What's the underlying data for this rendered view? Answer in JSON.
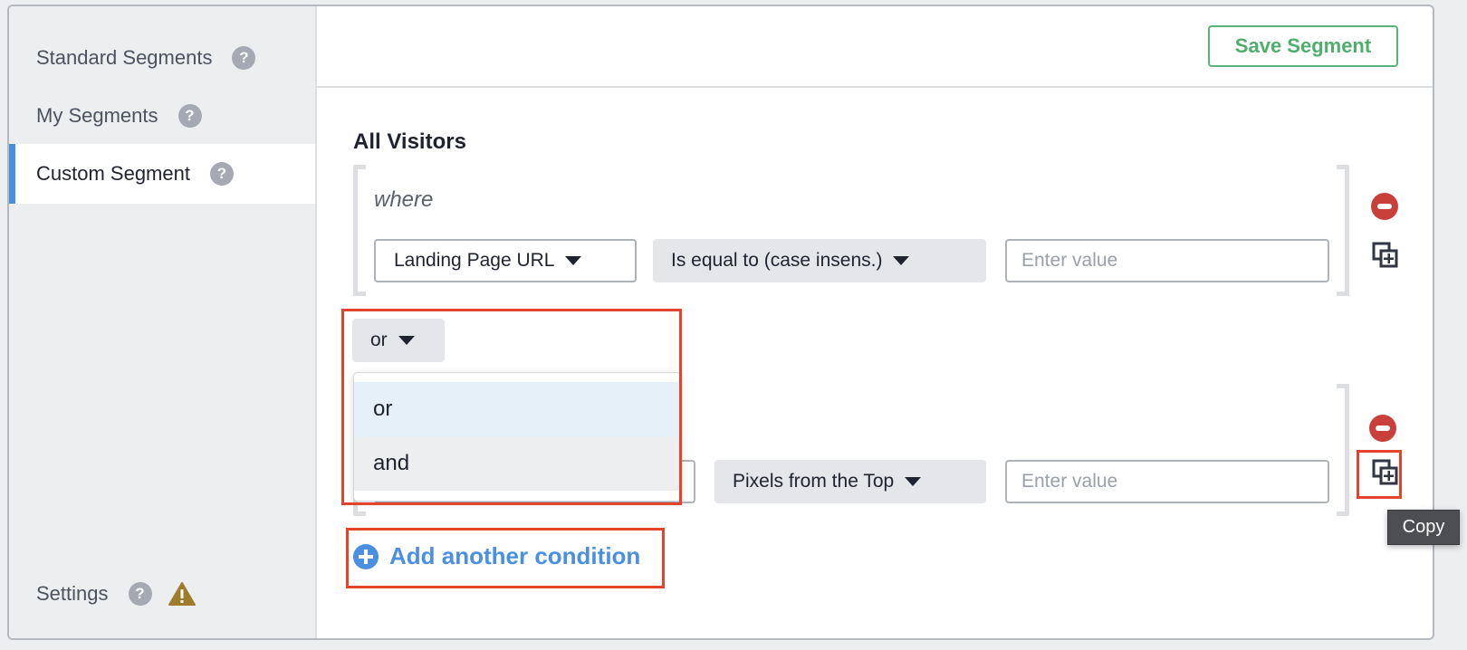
{
  "sidebar": {
    "items": [
      {
        "label": "Standard Segments",
        "help": "?"
      },
      {
        "label": "My Segments",
        "help": "?"
      },
      {
        "label": "Custom Segment",
        "help": "?",
        "active": true
      }
    ],
    "settings": {
      "label": "Settings",
      "help": "?",
      "warning": "!"
    }
  },
  "header": {
    "save_label": "Save Segment"
  },
  "builder": {
    "title": "All Visitors",
    "group1": {
      "where": "where",
      "field": "Landing Page URL",
      "operator": "Is equal to (case insens.)",
      "value_placeholder": "Enter value"
    },
    "connector": {
      "selected": "or",
      "options": [
        "or",
        "and"
      ]
    },
    "group2": {
      "field": "",
      "operator": "Pixels from the Top",
      "value_placeholder": "Enter value"
    },
    "add_label": "Add another condition",
    "tooltip": "Copy"
  },
  "colors": {
    "accent": "#4a8fe0",
    "save": "#4fae6e",
    "remove": "#c9403b",
    "highlight": "#e5442c",
    "warning": "#a07c2a"
  }
}
